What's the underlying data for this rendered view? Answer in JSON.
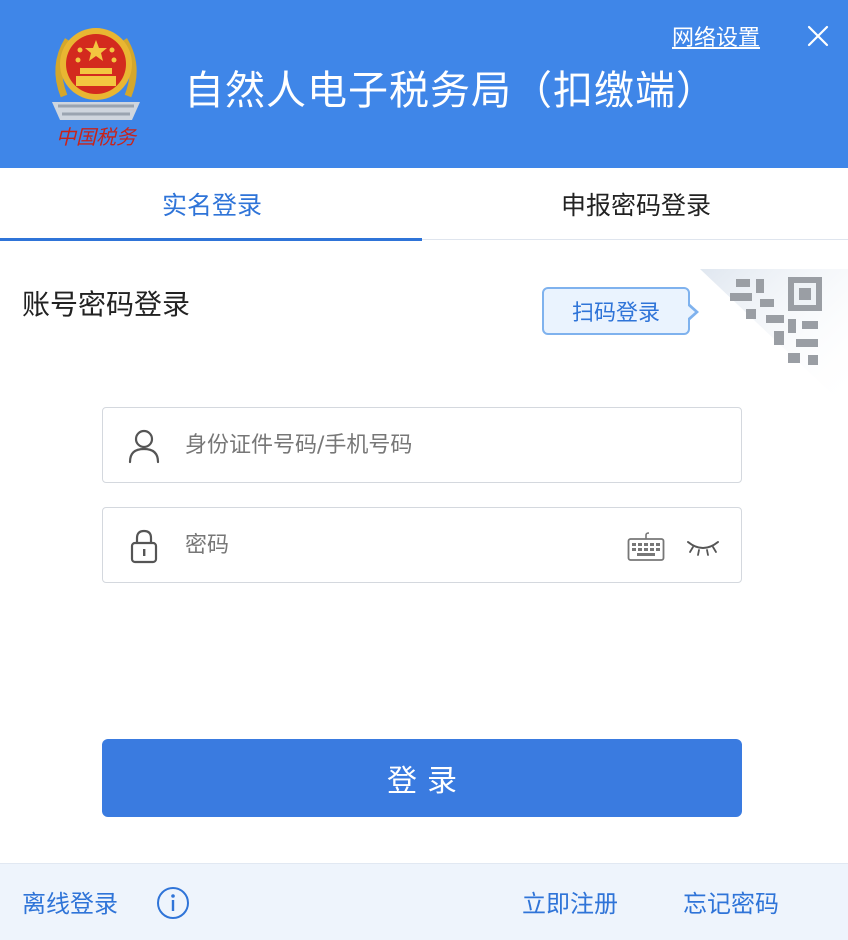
{
  "header": {
    "title": "自然人电子税务局（扣缴端）",
    "network_settings": "网络设置",
    "emblem_caption": "中国税务",
    "close_icon": "close-icon",
    "brand_color": "#3f86e8"
  },
  "tabs": [
    {
      "label": "实名登录",
      "active": true
    },
    {
      "label": "申报密码登录",
      "active": false
    }
  ],
  "login": {
    "section_title": "账号密码登录",
    "qr_tip": "扫码登录",
    "username": {
      "value": "",
      "placeholder": "身份证件号码/手机号码",
      "icon": "user-icon"
    },
    "password": {
      "value": "",
      "placeholder": "密码",
      "icon": "lock-icon"
    },
    "keyboard_icon": "keyboard-icon",
    "eye_icon": "eye-closed-icon",
    "submit_label": "登录",
    "accent_color": "#3a7be0"
  },
  "footer": {
    "offline_login": "离线登录",
    "info_icon": "info-icon",
    "register": "立即注册",
    "forgot_password": "忘记密码"
  }
}
